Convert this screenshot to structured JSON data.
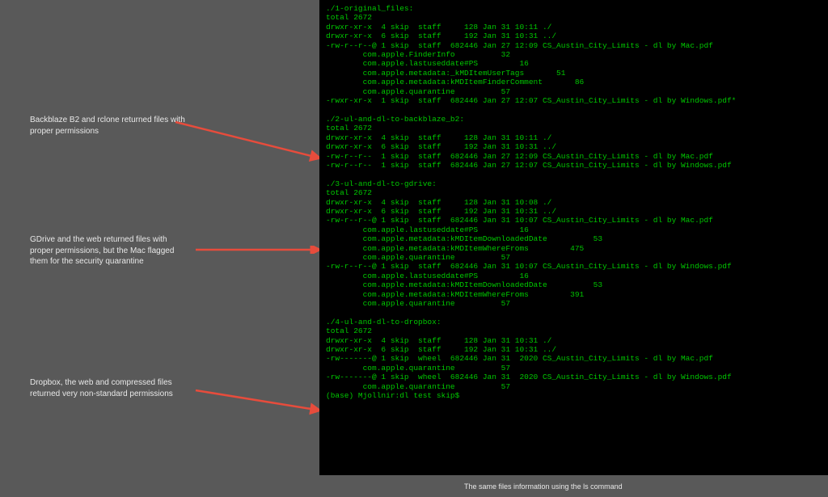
{
  "annotations": {
    "ann1": "Backblaze B2 and rclone returned files with proper permissions",
    "ann2": "GDrive and the web returned files with proper permissions, but the Mac flagged them for the security quarantine",
    "ann3": "Dropbox, the web and compressed files returned very non-standard permissions"
  },
  "terminal": "./1-original_files:\ntotal 2672\ndrwxr-xr-x  4 skip  staff     128 Jan 31 10:11 ./\ndrwxr-xr-x  6 skip  staff     192 Jan 31 10:31 ../\n-rw-r--r--@ 1 skip  staff  682446 Jan 27 12:09 CS_Austin_City_Limits - dl by Mac.pdf\n        com.apple.FinderInfo          32\n        com.apple.lastuseddate#PS         16\n        com.apple.metadata:_kMDItemUserTags       51\n        com.apple.metadata:kMDItemFinderComment       86\n        com.apple.quarantine          57\n-rwxr-xr-x  1 skip  staff  682446 Jan 27 12:07 CS_Austin_City_Limits - dl by Windows.pdf*\n\n./2-ul-and-dl-to-backblaze_b2:\ntotal 2672\ndrwxr-xr-x  4 skip  staff     128 Jan 31 10:11 ./\ndrwxr-xr-x  6 skip  staff     192 Jan 31 10:31 ../\n-rw-r--r--  1 skip  staff  682446 Jan 27 12:09 CS_Austin_City_Limits - dl by Mac.pdf\n-rw-r--r--  1 skip  staff  682446 Jan 27 12:07 CS_Austin_City_Limits - dl by Windows.pdf\n\n./3-ul-and-dl-to-gdrive:\ntotal 2672\ndrwxr-xr-x  4 skip  staff     128 Jan 31 10:08 ./\ndrwxr-xr-x  6 skip  staff     192 Jan 31 10:31 ../\n-rw-r--r--@ 1 skip  staff  682446 Jan 31 10:07 CS_Austin_City_Limits - dl by Mac.pdf\n        com.apple.lastuseddate#PS         16\n        com.apple.metadata:kMDItemDownloadedDate          53\n        com.apple.metadata:kMDItemWhereFroms         475\n        com.apple.quarantine          57\n-rw-r--r--@ 1 skip  staff  682446 Jan 31 10:07 CS_Austin_City_Limits - dl by Windows.pdf\n        com.apple.lastuseddate#PS         16\n        com.apple.metadata:kMDItemDownloadedDate          53\n        com.apple.metadata:kMDItemWhereFroms         391\n        com.apple.quarantine          57\n\n./4-ul-and-dl-to-dropbox:\ntotal 2672\ndrwxr-xr-x  4 skip  staff     128 Jan 31 10:31 ./\ndrwxr-xr-x  6 skip  staff     192 Jan 31 10:31 ../\n-rw-------@ 1 skip  wheel  682446 Jan 31  2020 CS_Austin_City_Limits - dl by Mac.pdf\n        com.apple.quarantine          57\n-rw-------@ 1 skip  wheel  682446 Jan 31  2020 CS_Austin_City_Limits - dl by Windows.pdf\n        com.apple.quarantine          57\n(base) Mjollnir:dl test skip$ ",
  "caption": "The same files information using the ls command"
}
